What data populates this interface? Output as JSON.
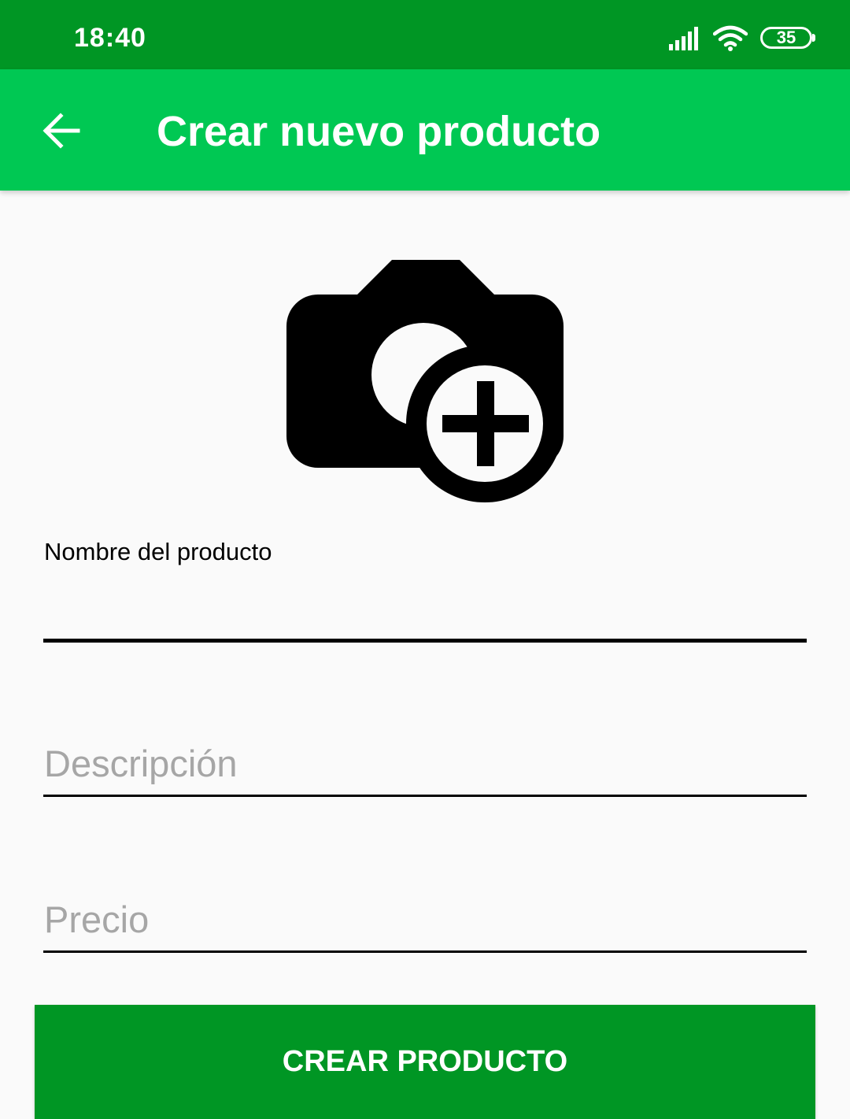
{
  "status_bar": {
    "time": "18:40",
    "battery_level": "35",
    "icons": [
      "signal-icon",
      "wifi-icon",
      "battery-icon"
    ]
  },
  "app_bar": {
    "back_icon": "arrow-left-icon",
    "title": "Crear nuevo producto"
  },
  "photo": {
    "icon": "add-a-photo-icon"
  },
  "form": {
    "name_label": "Nombre del producto",
    "name_value": "",
    "description_placeholder": "Descripción",
    "price_placeholder": "Precio"
  },
  "actions": {
    "create_label": "CREAR PRODUCTO"
  },
  "colors": {
    "status_bar": "#009624",
    "app_bar": "#00c853",
    "primary_button": "#009624",
    "background": "#fafafa",
    "placeholder_text": "#a6a6a6"
  }
}
